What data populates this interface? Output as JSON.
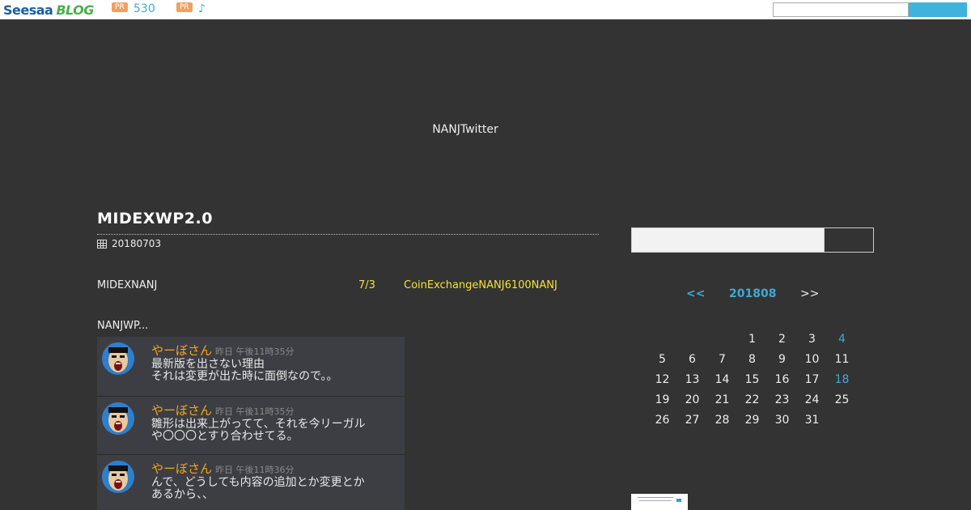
{
  "topbar": {
    "logo_part1": "Seesaa",
    "logo_part2": "BLOG",
    "pr1_badge": "PR",
    "pr1_text": "530",
    "pr2_badge": "PR",
    "pr2_text": "♪"
  },
  "header": {
    "title": "NANJTwitter"
  },
  "article": {
    "title": "MIDEXWP2.0",
    "date": "20180703",
    "line1_left": "MIDEXNANJ",
    "line1_mid": "7/3",
    "line1_right": "CoinExchangeNANJ6100NANJ",
    "line2": "NANJWP..."
  },
  "tweets": [
    {
      "name": "やーぼさん",
      "time": "昨日 午後11時35分",
      "msg": "最新版を出さない理由\nそれは変更が出た時に面倒なので。。"
    },
    {
      "name": "やーぼさん",
      "time": "昨日 午後11時35分",
      "msg": "雛形は出来上がってて、それを今リーガル\nや〇〇〇とすり合わせてる。"
    },
    {
      "name": "やーぼさん",
      "time": "昨日 午後11時36分",
      "msg": "んで、どうしても内容の追加とか変更とか\nあるから、、"
    }
  ],
  "sidebar": {
    "calendar": {
      "prev": "<<",
      "month": "201808",
      "next": ">>",
      "days": [
        {
          "d": "",
          "link": false
        },
        {
          "d": "",
          "link": false
        },
        {
          "d": "",
          "link": false
        },
        {
          "d": "1",
          "link": false
        },
        {
          "d": "2",
          "link": false
        },
        {
          "d": "3",
          "link": false
        },
        {
          "d": "4",
          "link": true
        },
        {
          "d": "5",
          "link": false
        },
        {
          "d": "6",
          "link": false
        },
        {
          "d": "7",
          "link": false
        },
        {
          "d": "8",
          "link": false
        },
        {
          "d": "9",
          "link": false
        },
        {
          "d": "10",
          "link": false
        },
        {
          "d": "11",
          "link": false
        },
        {
          "d": "12",
          "link": false
        },
        {
          "d": "13",
          "link": false
        },
        {
          "d": "14",
          "link": false
        },
        {
          "d": "15",
          "link": false
        },
        {
          "d": "16",
          "link": false
        },
        {
          "d": "17",
          "link": false
        },
        {
          "d": "18",
          "link": true
        },
        {
          "d": "19",
          "link": false
        },
        {
          "d": "20",
          "link": false
        },
        {
          "d": "21",
          "link": false
        },
        {
          "d": "22",
          "link": false
        },
        {
          "d": "23",
          "link": false
        },
        {
          "d": "24",
          "link": false
        },
        {
          "d": "25",
          "link": false
        },
        {
          "d": "26",
          "link": false
        },
        {
          "d": "27",
          "link": false
        },
        {
          "d": "28",
          "link": false
        },
        {
          "d": "29",
          "link": false
        },
        {
          "d": "30",
          "link": false
        },
        {
          "d": "31",
          "link": false
        }
      ]
    }
  },
  "colors": {
    "background": "#333333",
    "accent_blue": "#3fa9d6",
    "highlight_yellow": "#f3e03a",
    "tweet_name": "#f3a61c"
  }
}
